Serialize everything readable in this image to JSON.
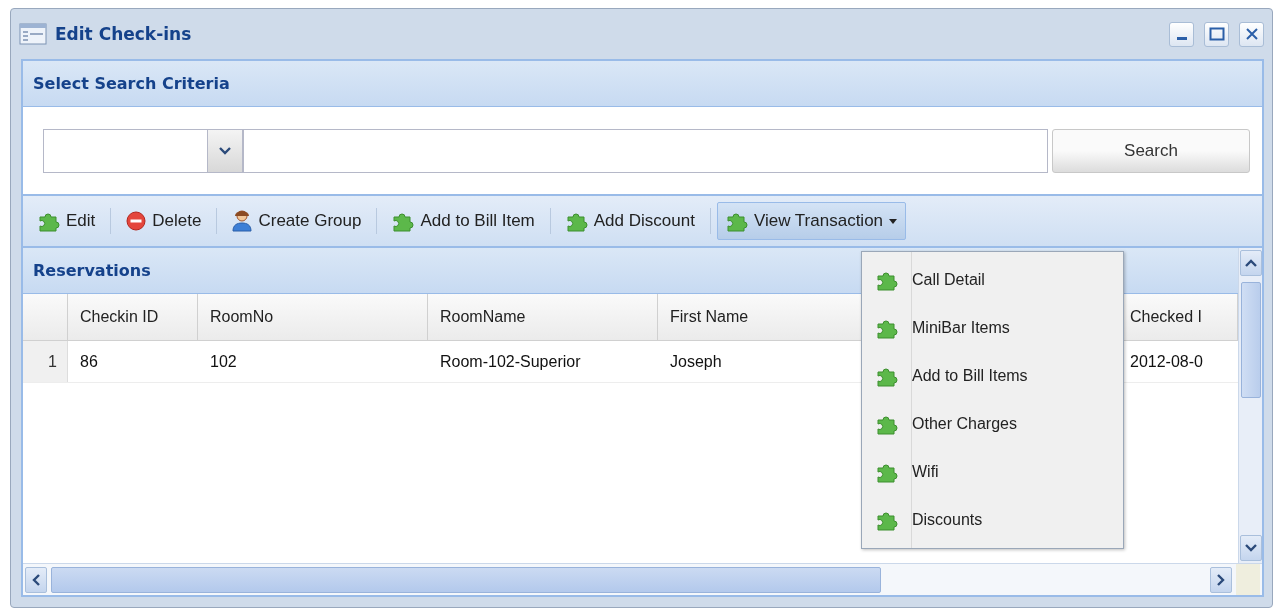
{
  "window": {
    "title": "Edit Check-ins"
  },
  "search_panel": {
    "title": "Select Search Criteria",
    "button": "Search"
  },
  "toolbar": [
    {
      "kind": "add",
      "label": "Edit"
    },
    {
      "kind": "delete",
      "label": "Delete"
    },
    {
      "kind": "group",
      "label": "Create Group"
    },
    {
      "kind": "add",
      "label": "Add to Bill Item"
    },
    {
      "kind": "add",
      "label": "Add Discount"
    },
    {
      "kind": "menu",
      "label": "View Transaction",
      "expanded": true,
      "items": [
        "Call Detail",
        "MiniBar Items",
        "Add to Bill Items",
        "Other Charges",
        "Wifi",
        "Discounts"
      ]
    }
  ],
  "grid": {
    "title": "Reservations",
    "columns": [
      "Checkin ID",
      "RoomNo",
      "RoomName",
      "First Name",
      "Checked I"
    ],
    "rows": [
      {
        "number": "1",
        "cells": [
          "86",
          "102",
          "Room-102-Superior",
          "Joseph",
          "2012-08-0"
        ]
      }
    ]
  }
}
